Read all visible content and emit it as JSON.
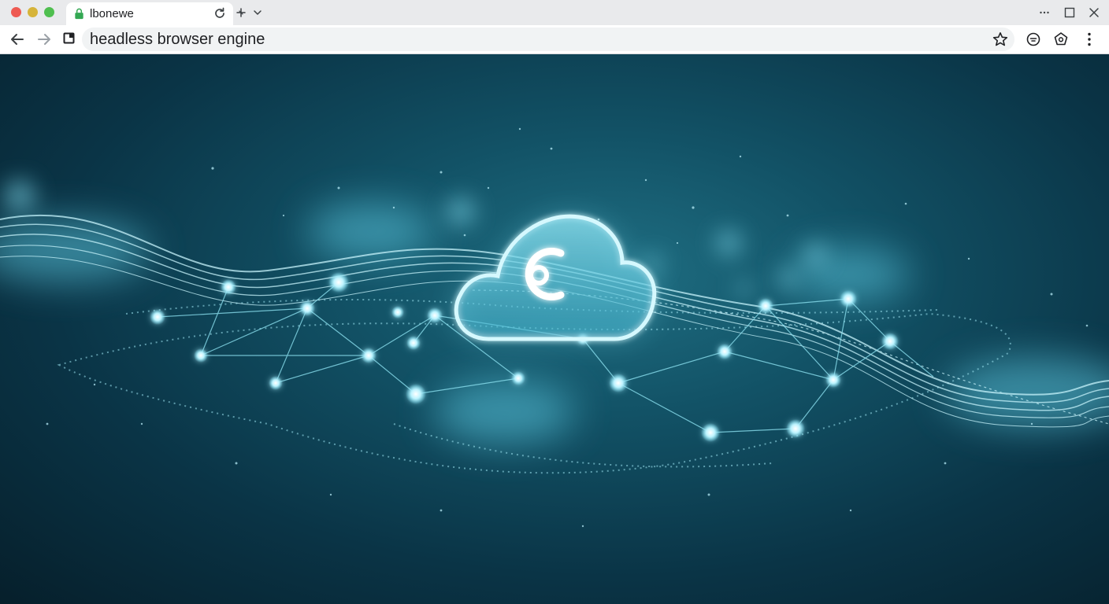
{
  "window": {
    "tab": {
      "title": "lbonewe"
    },
    "address_bar": {
      "value": "headless browser engine"
    }
  },
  "icons": {
    "tab_lock": "lock-icon",
    "tab_reload": "reload-icon",
    "new_tab": "new-tab-icon",
    "tab_list": "chevron-down-icon",
    "window_menu": "more-horizontal-icon",
    "maximize": "maximize-icon",
    "close": "close-icon",
    "back": "back-arrow-icon",
    "forward": "forward-arrow-icon",
    "page_info": "page-info-icon",
    "bookmark": "star-icon",
    "extension_1": "extension-icon",
    "extension_2": "extension-icon",
    "browser_menu": "more-vertical-icon"
  },
  "colors": {
    "tabstrip": "#e9eaec",
    "toolbar": "#ffffff",
    "omnibox": "#f1f3f4",
    "accent_glow": "#9be8f5",
    "background_dark": "#061f2b",
    "background_mid": "#125266"
  },
  "hero_image": {
    "subject": "glowing cloud with network nodes"
  }
}
